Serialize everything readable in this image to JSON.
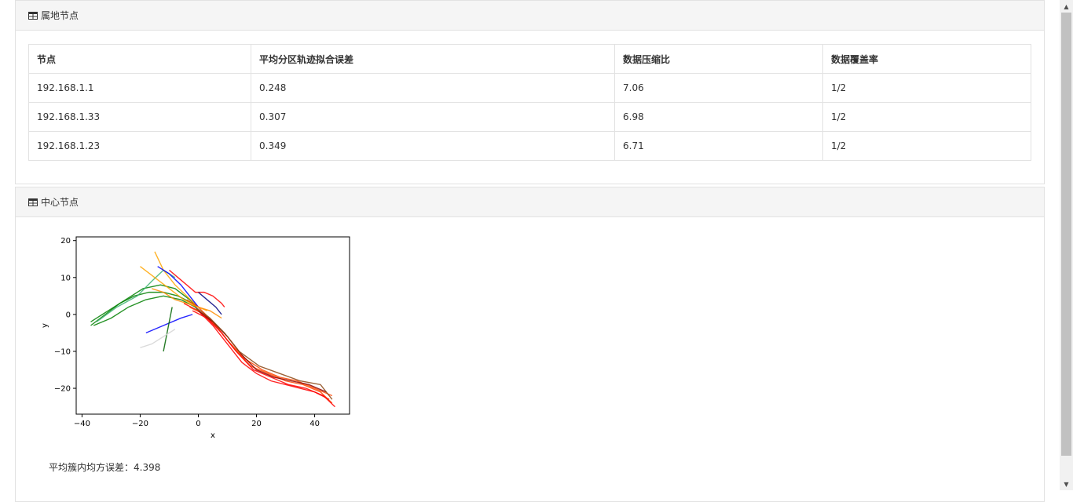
{
  "panel1": {
    "title": "属地节点",
    "icon": "table-icon",
    "table": {
      "headers": [
        "节点",
        "平均分区轨迹拟合误差",
        "数据压缩比",
        "数据覆盖率"
      ],
      "rows": [
        [
          "192.168.1.1",
          "0.248",
          "7.06",
          "1/2"
        ],
        [
          "192.168.1.33",
          "0.307",
          "6.98",
          "1/2"
        ],
        [
          "192.168.1.23",
          "0.349",
          "6.71",
          "1/2"
        ]
      ]
    }
  },
  "panel2": {
    "title": "中心节点",
    "icon": "table-icon",
    "metric": "平均簇内均方误差：4.398"
  },
  "chart_data": {
    "type": "line",
    "title": "",
    "xlabel": "x",
    "ylabel": "y",
    "xlim": [
      -42,
      52
    ],
    "ylim": [
      -27,
      21
    ],
    "xticks": [
      -40,
      -20,
      0,
      20,
      40
    ],
    "yticks": [
      20,
      10,
      0,
      -10,
      -20
    ],
    "xtick_labels": [
      "−40",
      "−20",
      "0",
      "20",
      "40"
    ],
    "ytick_labels": [
      "20",
      "10",
      "0",
      "−10",
      "−20"
    ],
    "grid": false,
    "series": [
      {
        "color": "#008000",
        "x": [
          -37,
          -32,
          -27,
          -22,
          -17,
          -12,
          -7,
          -2,
          0
        ],
        "y": [
          -3,
          0,
          3,
          5,
          6,
          6,
          5,
          3,
          1
        ]
      },
      {
        "color": "#008000",
        "x": [
          -37,
          -31,
          -25,
          -19,
          -13,
          -8,
          -3,
          0
        ],
        "y": [
          -2,
          1,
          4,
          7,
          8,
          7,
          4,
          2
        ]
      },
      {
        "color": "#008000",
        "x": [
          -36,
          -30,
          -24,
          -18,
          -12,
          -6,
          -1
        ],
        "y": [
          -3,
          -1,
          2,
          4,
          5,
          4,
          2
        ]
      },
      {
        "color": "#3cb371",
        "x": [
          -35,
          -28,
          -21,
          -16,
          -12,
          -8
        ],
        "y": [
          -2,
          2,
          5,
          9,
          12,
          10
        ]
      },
      {
        "color": "#ffa500",
        "x": [
          -20,
          -15,
          -10,
          -5,
          0,
          3
        ],
        "y": [
          13,
          10,
          7,
          4,
          2,
          1
        ]
      },
      {
        "color": "#ffa500",
        "x": [
          -15,
          -12,
          -8,
          -4,
          0
        ],
        "y": [
          17,
          12,
          8,
          5,
          2
        ]
      },
      {
        "color": "#0000ff",
        "x": [
          -14,
          -10,
          -6,
          -3,
          0
        ],
        "y": [
          13,
          11,
          8,
          5,
          2
        ]
      },
      {
        "color": "#0000ff",
        "x": [
          -18,
          -12,
          -6,
          -2
        ],
        "y": [
          -5,
          -3,
          -1,
          0
        ]
      },
      {
        "color": "#ff0000",
        "x": [
          -5,
          0,
          5,
          10,
          15,
          20,
          25,
          30,
          35,
          40,
          45
        ],
        "y": [
          3,
          1,
          -3,
          -8,
          -13,
          -16,
          -18,
          -19,
          -20,
          -21,
          -23
        ]
      },
      {
        "color": "#ff4500",
        "x": [
          -4,
          0,
          5,
          10,
          16,
          22,
          28,
          34,
          40,
          46
        ],
        "y": [
          4,
          2,
          -2,
          -7,
          -12,
          -15,
          -17,
          -18,
          -20,
          -22
        ]
      },
      {
        "color": "#ff4500",
        "x": [
          -3,
          2,
          7,
          12,
          18,
          24,
          30,
          36,
          42,
          46
        ],
        "y": [
          2,
          0,
          -4,
          -9,
          -14,
          -16,
          -18,
          -19,
          -21,
          -24
        ]
      },
      {
        "color": "#ff0000",
        "x": [
          -2,
          3,
          8,
          13,
          19,
          25,
          31,
          37,
          43,
          47
        ],
        "y": [
          1,
          -1,
          -5,
          -10,
          -15,
          -17,
          -19,
          -20,
          -22,
          -25
        ]
      },
      {
        "color": "#8b0000",
        "x": [
          0,
          5,
          10,
          15,
          20,
          26,
          32,
          38,
          44
        ],
        "y": [
          1,
          -2,
          -6,
          -11,
          -15,
          -17,
          -18,
          -19,
          -21
        ]
      },
      {
        "color": "#8b4513",
        "x": [
          -1,
          4,
          9,
          14,
          21,
          28,
          35,
          42,
          46
        ],
        "y": [
          2,
          -1,
          -5,
          -10,
          -14,
          -16,
          -18,
          -19,
          -23
        ]
      },
      {
        "color": "#ff0000",
        "x": [
          -10,
          -7,
          -4,
          -1,
          2,
          5,
          8,
          9
        ],
        "y": [
          12,
          10,
          8,
          6,
          6,
          5,
          3,
          2
        ]
      },
      {
        "color": "#ff8c00",
        "x": [
          -16,
          -12,
          -8,
          -4,
          0,
          4,
          8
        ],
        "y": [
          7,
          6,
          4,
          3,
          2,
          1,
          -1
        ]
      },
      {
        "color": "#000080",
        "x": [
          0,
          3,
          6,
          8
        ],
        "y": [
          6,
          4,
          2,
          0
        ]
      },
      {
        "color": "#006400",
        "x": [
          -12,
          -11,
          -10,
          -9
        ],
        "y": [
          -10,
          -6,
          -2,
          2
        ]
      },
      {
        "color": "#d3d3d3",
        "x": [
          -20,
          -16,
          -12,
          -8
        ],
        "y": [
          -9,
          -8,
          -6,
          -4
        ]
      }
    ]
  }
}
